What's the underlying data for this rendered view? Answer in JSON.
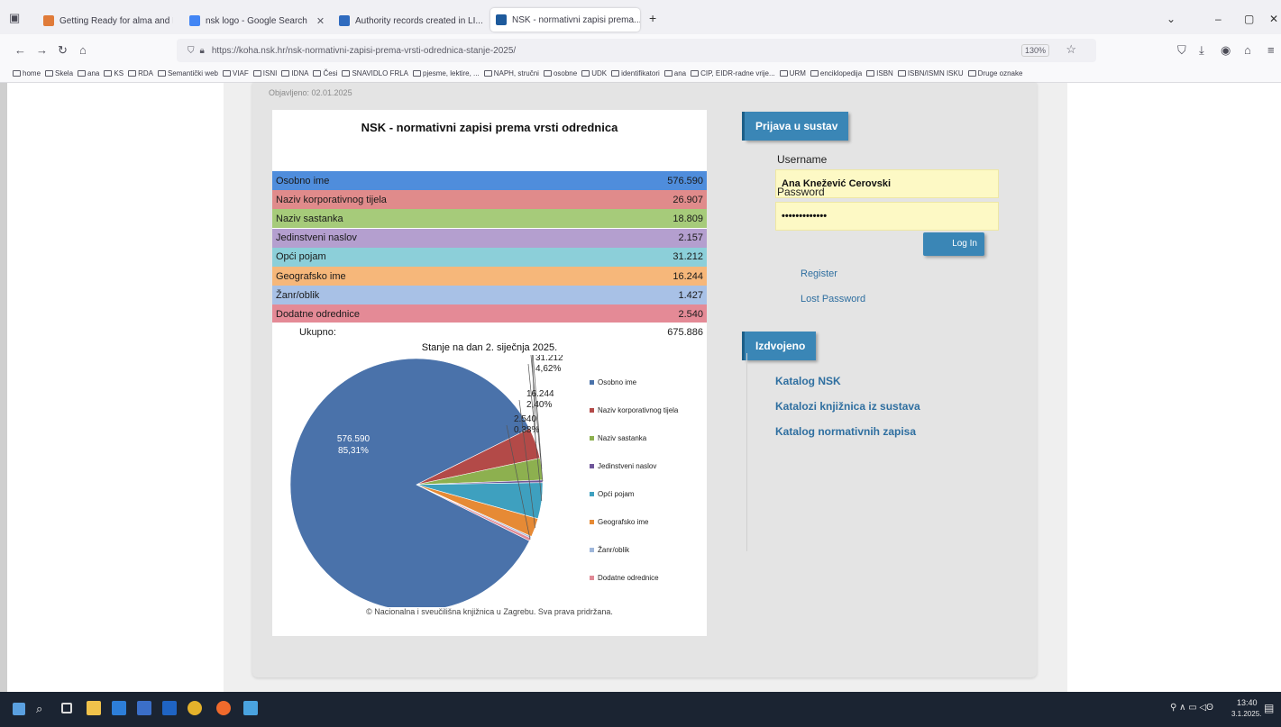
{
  "browser": {
    "tabs": [
      {
        "title": "Getting Ready for alma and Dr...",
        "color": "#e07b39"
      },
      {
        "title": "nsk logo - Google Search",
        "color": "#4285f4"
      },
      {
        "title": "Authority records created in LI...",
        "color": "#2f6bbf"
      },
      {
        "title": "NSK - normativni zapisi prema...",
        "color": "#1d5a9c"
      }
    ],
    "new_tab": "+",
    "url": "https://koha.nsk.hr/nsk-normativni-zapisi-prema-vrsti-odrednica-stanje-2025/",
    "zoom": "130%",
    "bookmarks": [
      "home",
      "Skela",
      "ana",
      "KS",
      "RDA",
      "Semantički web",
      "VIAF",
      "ISNI",
      "IDNA",
      "Česi",
      "SNAVIDLO FRLA",
      "pjesme, lektire, ...",
      "NAPH, stručni",
      "osobne",
      "UDK",
      "identifikatori",
      "ana",
      "CIP, EIDR-radne vrije...",
      "URM",
      "enciklopedija",
      "ISBN",
      "ISBN/ISMN ISKU",
      "Druge oznake"
    ]
  },
  "page": {
    "published": "Objavljeno: 02.01.2025"
  },
  "chart_data": {
    "type": "pie",
    "title": "NSK - normativni zapisi prema vrsti odrednica",
    "subtitle": "Stanje na dan 2. siječnja 2025.",
    "categories": [
      "Osobno ime",
      "Naziv korporativnog tijela",
      "Naziv sastanka",
      "Jedinstveni naslov",
      "Opći pojam",
      "Geografsko ime",
      "Žanr/oblik",
      "Dodatne odrednice"
    ],
    "table_labels": [
      "Osobno ime",
      "Naziv korporativnog tijela",
      "Naziv sastanka",
      "Jedinstveni naslov",
      "Opći pojam",
      "Geografsko ime",
      "Žanr/oblik",
      "Dodatne odrednice"
    ],
    "values": [
      576590,
      26907,
      18809,
      2157,
      31212,
      16244,
      1427,
      2540
    ],
    "value_labels": [
      "576.590",
      "26.907",
      "18.809",
      "2.157",
      "31.212",
      "16.244",
      "1.427",
      "2.540"
    ],
    "percent_labels": [
      "85,31%",
      "3,98%",
      "2,78%",
      "0,32%",
      "4,62%",
      "2,40%",
      "",
      "0,38%"
    ],
    "row_colors": [
      "#4f8ddc",
      "#e08b8b",
      "#a6cb7a",
      "#b49fcf",
      "#8ccfd9",
      "#f6b77a",
      "#a8c1e6",
      "#e48a96"
    ],
    "slice_colors": [
      "#4a72aa",
      "#b34a48",
      "#8db04f",
      "#6f569a",
      "#3ea0bf",
      "#e68a35",
      "#9eb6da",
      "#e08a96"
    ],
    "total_label": "Ukupno:",
    "total_value": "675.886",
    "legend_placement": "right",
    "copyright": "© Nacionalna i sveučilišna knjižnica u Zagrebu. Sva prava pridržana."
  },
  "sidebar": {
    "login_header": "Prijava u sustav",
    "username_label": "Username",
    "username_value": "Ana Knežević Cerovski",
    "password_label": "Password",
    "password_value": "•••••••••••••",
    "login_button": "Log In",
    "register_link": "Register",
    "lost_password_link": "Lost Password",
    "featured_header": "Izdvojeno",
    "links": [
      "Katalog NSK",
      "Katalozi knjižnica iz sustava",
      "Katalog normativnih zapisa"
    ]
  },
  "taskbar": {
    "time": "13:40",
    "date": "3.1.2025."
  }
}
